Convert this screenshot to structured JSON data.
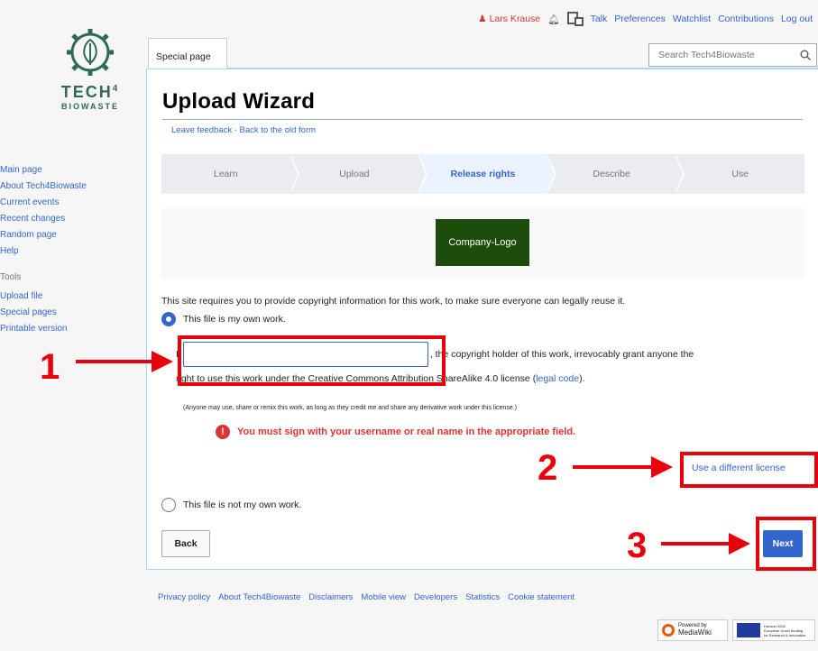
{
  "personal": {
    "username": "Lars Krause",
    "talk": "Talk",
    "preferences": "Preferences",
    "watchlist": "Watchlist",
    "contributions": "Contributions",
    "logout": "Log out"
  },
  "logo": {
    "line1": "TECH",
    "superscript": "4",
    "line2": "BIOWASTE"
  },
  "sidebar": {
    "nav": [
      "Main page",
      "About Tech4Biowaste",
      "Current events",
      "Recent changes",
      "Random page",
      "Help"
    ],
    "tools_heading": "Tools",
    "tools": [
      "Upload file",
      "Special pages",
      "Printable version"
    ]
  },
  "tab": {
    "label": "Special page"
  },
  "search": {
    "placeholder": "Search Tech4Biowaste"
  },
  "page": {
    "title": "Upload Wizard",
    "feedback": "Leave feedback",
    "separator": "·",
    "old_form": "Back to the old form"
  },
  "steps": [
    "Learn",
    "Upload",
    "Release rights",
    "Describe",
    "Use"
  ],
  "active_step": "Release rights",
  "thumbnail": {
    "label": "Company-Logo"
  },
  "rights": {
    "notice": "This site requires you to provide copyright information for this work, to make sure everyone can legally reuse it.",
    "own_work": "This file is my own work.",
    "grant_prefix": "I,",
    "grant_text_1": ", the copyright holder of this work, irrevocably grant anyone the",
    "grant_text_2": "right to use this work under the Creative Commons Attribution ShareAlike 4.0 license (",
    "legal_code": "legal code",
    "grant_text_3": ").",
    "small_print": "(Anyone may use, share or remix this work, as long as they credit me and share any derivative work under this license.)",
    "error": "You must sign with your username or real name in the appropriate field.",
    "different_license": "Use a different license",
    "not_own_work": "This file is not my own work.",
    "input_value": ""
  },
  "buttons": {
    "back": "Back",
    "next": "Next"
  },
  "footer": [
    "Privacy policy",
    "About Tech4Biowaste",
    "Disclaimers",
    "Mobile view",
    "Developers",
    "Statistics",
    "Cookie statement"
  ],
  "badges": {
    "mediawiki_1": "Powered by",
    "mediawiki_2": "MediaWiki",
    "eu_1": "Horizon 2020",
    "eu_2": "European Union funding",
    "eu_3": "for Research & Innovation"
  },
  "annotations": [
    "1",
    "2",
    "3"
  ],
  "colors": {
    "link": "#3366cc",
    "annotation": "#e8000b",
    "error": "#d33",
    "thumbnail": "#1e4d0b"
  }
}
